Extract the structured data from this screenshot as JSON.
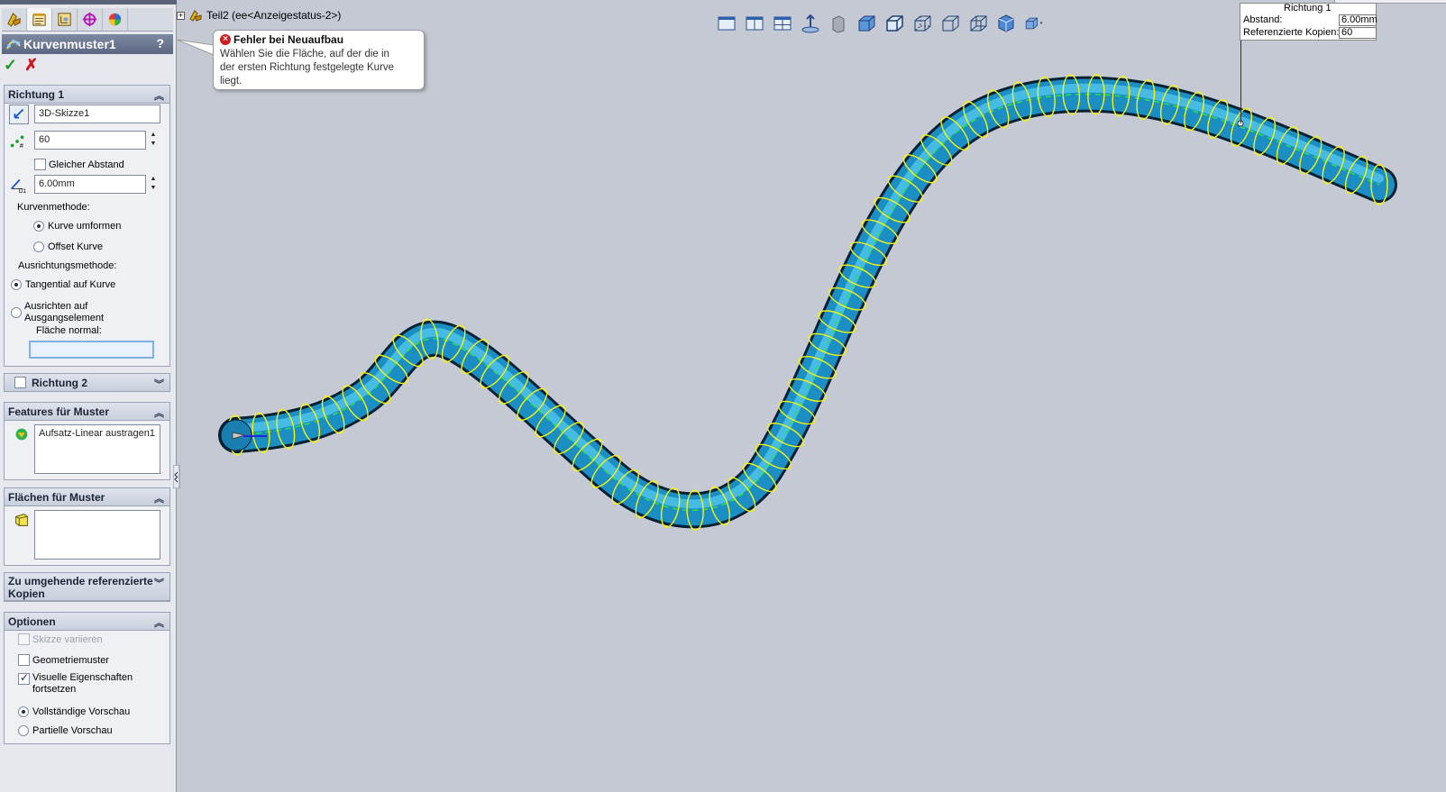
{
  "colors": {
    "accent": "#5b6782",
    "tube": "#1b8ec4",
    "preview": "#f5f50a",
    "error": "#d01c1c",
    "viewport": "#c4c9d3"
  },
  "tabs": [
    {
      "icon": "feature-manager-icon"
    },
    {
      "icon": "property-manager-icon"
    },
    {
      "icon": "configuration-manager-icon"
    },
    {
      "icon": "dimxpert-icon"
    },
    {
      "icon": "display-manager-icon"
    }
  ],
  "pm": {
    "title": "Kurvenmuster1",
    "help": "?",
    "ok": "✓",
    "cancel": "✗"
  },
  "richtung1": {
    "header": "Richtung 1",
    "curve": "3D-Skizze1",
    "count": "60",
    "equal_spacing": "Gleicher Abstand",
    "spacing": "6.00mm",
    "curve_method_label": "Kurvenmethode:",
    "curve_methods": [
      "Kurve umformen",
      "Offset Kurve"
    ],
    "align_method_label": "Ausrichtungsmethode:",
    "align_tangent": "Tangential auf Kurve",
    "align_seed_line1": "Ausrichten auf",
    "align_seed_line2": "Ausgangselement",
    "face_normal_label": "Fläche normal:"
  },
  "richtung2": {
    "header": "Richtung 2"
  },
  "features": {
    "header": "Features für Muster",
    "items": [
      "Aufsatz-Linear austragen1"
    ]
  },
  "faces": {
    "header": "Flächen für Muster"
  },
  "skip": {
    "header_line1": "Zu umgehende referenzierte",
    "header_line2": "Kopien"
  },
  "options": {
    "header": "Optionen",
    "vary_sketch": "Skizze variieren",
    "geometry_pattern": "Geometriemuster",
    "propagate_line1": "Visuelle Eigenschaften",
    "propagate_line2": "fortsetzen",
    "full_preview": "Vollständige Vorschau",
    "partial_preview": "Partielle Vorschau"
  },
  "tree": {
    "label": "Teil2  (ee<Anzeigestatus-2>)"
  },
  "error": {
    "title": "Fehler bei Neuaufbau",
    "line1": "Wählen Sie die Fläche, auf der die in",
    "line2": "der ersten Richtung festgelegte Kurve",
    "line3": "liegt."
  },
  "callout": {
    "title": "Richtung 1",
    "spacing_label": "Abstand:",
    "spacing_value": "6.00mm",
    "copies_label": "Referenzierte Kopien:",
    "copies_value": "60"
  },
  "view_buttons": [
    "single-view-icon",
    "two-view-icon",
    "four-view-icon",
    "normal-to-icon",
    "section-view-icon",
    "shaded-icon",
    "shaded-edges-icon",
    "hidden-lines-visible-icon",
    "hidden-lines-removed-icon",
    "wireframe-icon",
    "iso-view-icon",
    "view-orientation-icon"
  ]
}
